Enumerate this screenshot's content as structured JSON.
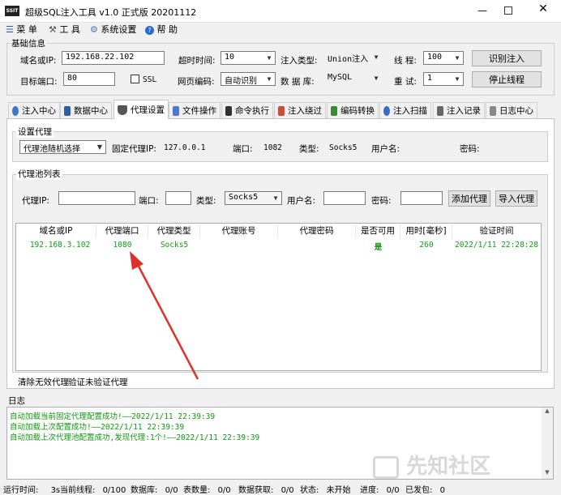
{
  "window": {
    "title": "超级SQL注入工具 v1.0 正式版 20201112",
    "logo": "SSIT"
  },
  "menu": [
    {
      "label": "菜 单",
      "icon": "menu-icon"
    },
    {
      "label": "工 具",
      "icon": "wrench-icon"
    },
    {
      "label": "系统设置",
      "icon": "gear-icon"
    },
    {
      "label": "帮 助",
      "icon": "help-icon"
    }
  ],
  "basic": {
    "title": "基础信息",
    "domain_label": "域名或IP:",
    "domain_value": "192.168.22.102",
    "timeout_label": "超时时间:",
    "timeout_value": "10",
    "inject_type_label": "注入类型:",
    "inject_type_value": "Union注入",
    "threads_label": "线 程:",
    "threads_value": "100",
    "identify_btn": "识别注入",
    "port_label": "目标端口:",
    "port_value": "80",
    "ssl_label": "SSL",
    "encoding_label": "网页编码:",
    "encoding_value": "自动识别",
    "db_label": "数 据 库:",
    "db_value": "MySQL",
    "retry_label": "重 试:",
    "retry_value": "1",
    "stop_btn": "停止线程"
  },
  "tabs": [
    {
      "label": "注入中心",
      "icon": "gear-icon",
      "color": "#3b78c8"
    },
    {
      "label": "数据中心",
      "icon": "database-icon",
      "color": "#2b5fa8"
    },
    {
      "label": "代理设置",
      "icon": "shield-icon",
      "color": "#555555"
    },
    {
      "label": "文件操作",
      "icon": "file-icon",
      "color": "#4a7bd0"
    },
    {
      "label": "命令执行",
      "icon": "terminal-icon",
      "color": "#333333"
    },
    {
      "label": "注入绕过",
      "icon": "bypass-icon",
      "color": "#d04a3a"
    },
    {
      "label": "编码转换",
      "icon": "convert-icon",
      "color": "#3a8a3a"
    },
    {
      "label": "注入扫描",
      "icon": "scan-icon",
      "color": "#3a6ac8"
    },
    {
      "label": "注入记录",
      "icon": "record-icon",
      "color": "#666666"
    },
    {
      "label": "日志中心",
      "icon": "log-icon",
      "color": "#888888"
    }
  ],
  "proxy": {
    "title": "设置代理",
    "mode_value": "代理池随机选择",
    "fixed_label": "固定代理IP:",
    "fixed_value": "127.0.0.1",
    "port_label": "端口:",
    "port_value": "1082",
    "type_label": "类型:",
    "type_value": "Socks5",
    "user_label": "用户名:",
    "pass_label": "密码:"
  },
  "pool": {
    "title": "代理池列表",
    "ip_label": "代理IP:",
    "port_label": "端口:",
    "type_label": "类型:",
    "type_value": "Socks5",
    "user_label": "用户名:",
    "pass_label": "密码:",
    "add_btn": "添加代理",
    "import_btn": "导入代理",
    "columns": [
      "域名或IP",
      "代理端口",
      "代理类型",
      "代理账号",
      "代理密码",
      "是否可用",
      "用时[毫秒]",
      "验证时间"
    ],
    "rows": [
      [
        "192.168.3.102",
        "1080",
        "Socks5",
        "",
        "",
        "是",
        "260",
        "2022/1/11 22:28:28"
      ]
    ],
    "bottom_links": [
      "清除无效代理",
      "验证未验证代理"
    ]
  },
  "log": {
    "title": "日志",
    "lines": [
      "自动加载当前固定代理配置成功!——2022/1/11 22:39:39",
      "自动加载上次配置成功!——2022/1/11 22:39:39",
      "自动加载上次代理池配置成功,发现代理:1个!——2022/1/11 22:39:39"
    ]
  },
  "status": {
    "run_time_label": "运行时间:",
    "run_time": "3s",
    "threads_label": "当前线程:",
    "threads": "0/100",
    "db_label": "数据库:",
    "db": "0/0",
    "tables_label": "表数量:",
    "tables": "0/0",
    "data_label": "数据获取:",
    "data": "0/0",
    "state_label": "状态:",
    "state": "未开始",
    "progress_label": "进度:",
    "progress": "0/0",
    "sent_label": "已发包:",
    "sent": "0"
  },
  "watermark": "先知社区",
  "colors": {
    "log_green": "#0a9a0a",
    "row_green": "#119a11",
    "arrow_red": "#e0302a"
  }
}
